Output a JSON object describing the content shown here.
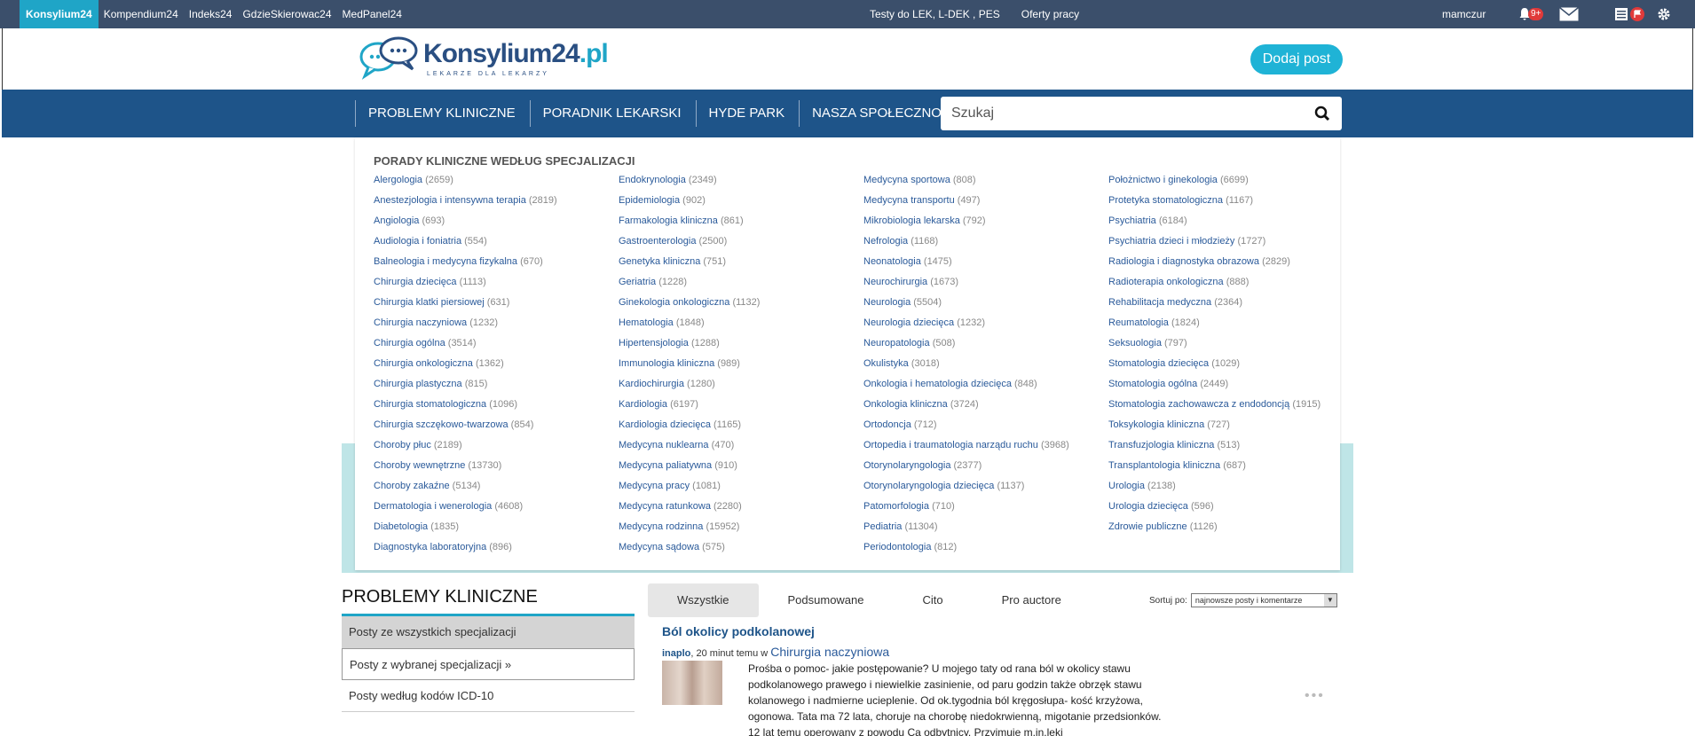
{
  "topbar": {
    "links": [
      "Konsylium24",
      "Kompendium24",
      "Indeks24",
      "GdzieSkierowac24",
      "MedPanel24"
    ],
    "center": [
      "Testy do LEK, L-DEK , PES",
      "Oferty pracy"
    ],
    "username": "mamczur",
    "notif_badge": "9+"
  },
  "header": {
    "logo_name": "Konsylium24",
    "logo_tld": ".pl",
    "logo_tagline": "LEKARZE DLA LEKARZY",
    "add_post": "Dodaj post"
  },
  "nav": {
    "items": [
      "PROBLEMY KLINICZNE",
      "PORADNIK LEKARSKI",
      "HYDE PARK",
      "NASZA SPOŁECZNOŚĆ"
    ],
    "search_placeholder": "Szukaj"
  },
  "dropdown": {
    "title": "PORADY KLINICZNE WEDŁUG SPECJALIZACJI",
    "columns": [
      [
        [
          "Alergologia",
          "(2659)"
        ],
        [
          "Anestezjologia i intensywna terapia",
          "(2819)"
        ],
        [
          "Angiologia",
          "(693)"
        ],
        [
          "Audiologia i foniatria",
          "(554)"
        ],
        [
          "Balneologia i medycyna fizykalna",
          "(670)"
        ],
        [
          "Chirurgia dziecięca",
          "(1113)"
        ],
        [
          "Chirurgia klatki piersiowej",
          "(631)"
        ],
        [
          "Chirurgia naczyniowa",
          "(1232)"
        ],
        [
          "Chirurgia ogólna",
          "(3514)"
        ],
        [
          "Chirurgia onkologiczna",
          "(1362)"
        ],
        [
          "Chirurgia plastyczna",
          "(815)"
        ],
        [
          "Chirurgia stomatologiczna",
          "(1096)"
        ],
        [
          "Chirurgia szczękowo-twarzowa",
          "(854)"
        ],
        [
          "Choroby płuc",
          "(2189)"
        ],
        [
          "Choroby wewnętrzne",
          "(13730)"
        ],
        [
          "Choroby zakaźne",
          "(5134)"
        ],
        [
          "Dermatologia i wenerologia",
          "(4608)"
        ],
        [
          "Diabetologia",
          "(1835)"
        ],
        [
          "Diagnostyka laboratoryjna",
          "(896)"
        ]
      ],
      [
        [
          "Endokrynologia",
          "(2349)"
        ],
        [
          "Epidemiologia",
          "(902)"
        ],
        [
          "Farmakologia kliniczna",
          "(861)"
        ],
        [
          "Gastroenterologia",
          "(2500)"
        ],
        [
          "Genetyka kliniczna",
          "(751)"
        ],
        [
          "Geriatria",
          "(1228)"
        ],
        [
          "Ginekologia onkologiczna",
          "(1132)"
        ],
        [
          "Hematologia",
          "(1848)"
        ],
        [
          "Hipertensjologia",
          "(1288)"
        ],
        [
          "Immunologia kliniczna",
          "(989)"
        ],
        [
          "Kardiochirurgia",
          "(1280)"
        ],
        [
          "Kardiologia",
          "(6197)"
        ],
        [
          "Kardiologia dziecięca",
          "(1165)"
        ],
        [
          "Medycyna nuklearna",
          "(470)"
        ],
        [
          "Medycyna paliatywna",
          "(910)"
        ],
        [
          "Medycyna pracy",
          "(1081)"
        ],
        [
          "Medycyna ratunkowa",
          "(2280)"
        ],
        [
          "Medycyna rodzinna",
          "(15952)"
        ],
        [
          "Medycyna sądowa",
          "(575)"
        ]
      ],
      [
        [
          "Medycyna sportowa",
          "(808)"
        ],
        [
          "Medycyna transportu",
          "(497)"
        ],
        [
          "Mikrobiologia lekarska",
          "(792)"
        ],
        [
          "Nefrologia",
          "(1168)"
        ],
        [
          "Neonatologia",
          "(1475)"
        ],
        [
          "Neurochirurgia",
          "(1673)"
        ],
        [
          "Neurologia",
          "(5504)"
        ],
        [
          "Neurologia dziecięca",
          "(1232)"
        ],
        [
          "Neuropatologia",
          "(508)"
        ],
        [
          "Okulistyka",
          "(3018)"
        ],
        [
          "Onkologia i hematologia dziecięca",
          "(848)"
        ],
        [
          "Onkologia kliniczna",
          "(3724)"
        ],
        [
          "Ortodoncja",
          "(712)"
        ],
        [
          "Ortopedia i traumatologia narządu ruchu",
          "(3968)"
        ],
        [
          "Otorynolaryngologia",
          "(2377)"
        ],
        [
          "Otorynolaryngologia dziecięca",
          "(1137)"
        ],
        [
          "Patomorfologia",
          "(710)"
        ],
        [
          "Pediatria",
          "(11304)"
        ],
        [
          "Periodontologia",
          "(812)"
        ]
      ],
      [
        [
          "Położnictwo i ginekologia",
          "(6699)"
        ],
        [
          "Protetyka stomatologiczna",
          "(1167)"
        ],
        [
          "Psychiatria",
          "(6184)"
        ],
        [
          "Psychiatria dzieci i młodzieży",
          "(1727)"
        ],
        [
          "Radiologia i diagnostyka obrazowa",
          "(2829)"
        ],
        [
          "Radioterapia onkologiczna",
          "(888)"
        ],
        [
          "Rehabilitacja medyczna",
          "(2364)"
        ],
        [
          "Reumatologia",
          "(1824)"
        ],
        [
          "Seksuologia",
          "(797)"
        ],
        [
          "Stomatologia dziecięca",
          "(1029)"
        ],
        [
          "Stomatologia ogólna",
          "(2449)"
        ],
        [
          "Stomatologia zachowawcza z endodoncją",
          "(1915)"
        ],
        [
          "Toksykologia kliniczna",
          "(727)"
        ],
        [
          "Transfuzjologia kliniczna",
          "(513)"
        ],
        [
          "Transplantologia kliniczna",
          "(687)"
        ],
        [
          "Urologia",
          "(2138)"
        ],
        [
          "Urologia dziecięca",
          "(596)"
        ],
        [
          "Zdrowie publiczne",
          "(1126)"
        ]
      ]
    ]
  },
  "section": {
    "title": "PROBLEMY KLINICZNE",
    "side": [
      "Posty ze wszystkich specjalizacji",
      "Posty z wybranej specjalizacji »",
      "Posty według kodów ICD-10"
    ]
  },
  "tabs": [
    "Wszystkie",
    "Podsumowane",
    "Cito",
    "Pro auctore"
  ],
  "sort": {
    "label": "Sortuj po:",
    "value": "najnowsze posty i komentarze"
  },
  "post": {
    "title": "Ból okolicy podkolanowej",
    "author": "inaplo",
    "time": ", 20 minut temu w",
    "spec": "Chirurgia naczyniowa",
    "body": "Prośba o pomoc- jakie postępowanie? U mojego taty od rana ból w okolicy stawu podkolanowego prawego i niewielkie zasinienie, od paru godzin także obrzęk stawu kolanowego i nadmierne ucieplenie. Od ok.tygodnia ból kręgosłupa- kość krzyżowa, ogonowa. Tata ma 72 lata, choruje na chorobę niedokrwienną, migotanie przedsionków. 12 lat temu operowany z powodu Ca odbytnicy. Przyjmuje m.in.leki"
  },
  "colors": {
    "topbar": "#3b4f6b",
    "accent": "#1fa5c7",
    "nav": "#1e5489",
    "link": "#2a5a9a"
  }
}
